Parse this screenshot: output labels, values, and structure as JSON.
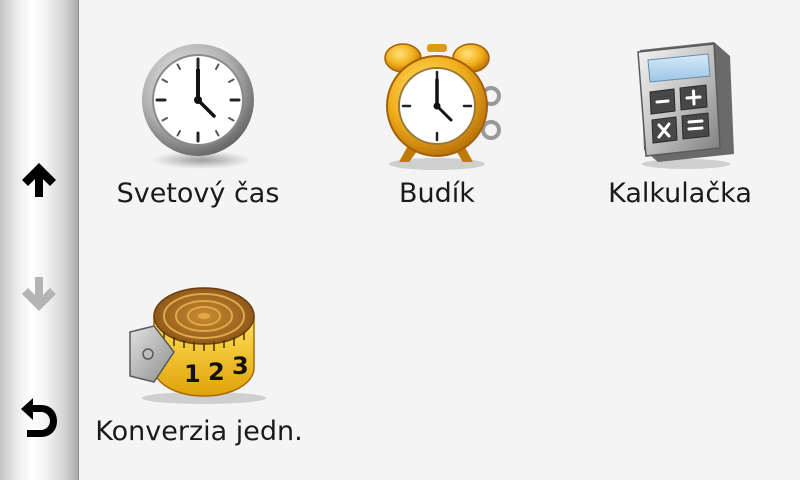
{
  "sidebar": {
    "up_icon": "arrow-up-icon",
    "down_icon": "arrow-down-icon",
    "back_icon": "back-arrow-icon"
  },
  "apps": [
    {
      "label": "Svetový čas",
      "icon": "world-clock-icon"
    },
    {
      "label": "Budík",
      "icon": "alarm-clock-icon"
    },
    {
      "label": "Kalkulačka",
      "icon": "calculator-icon"
    },
    {
      "label": "Konverzia jedn.",
      "icon": "measuring-tape-icon"
    }
  ],
  "colors": {
    "background": "#f4f4f4",
    "arrow_active": "#000000",
    "arrow_disabled": "#b4b4b4",
    "alarm_gold": "#f2b01c",
    "tape_yellow": "#f7cf2a"
  }
}
